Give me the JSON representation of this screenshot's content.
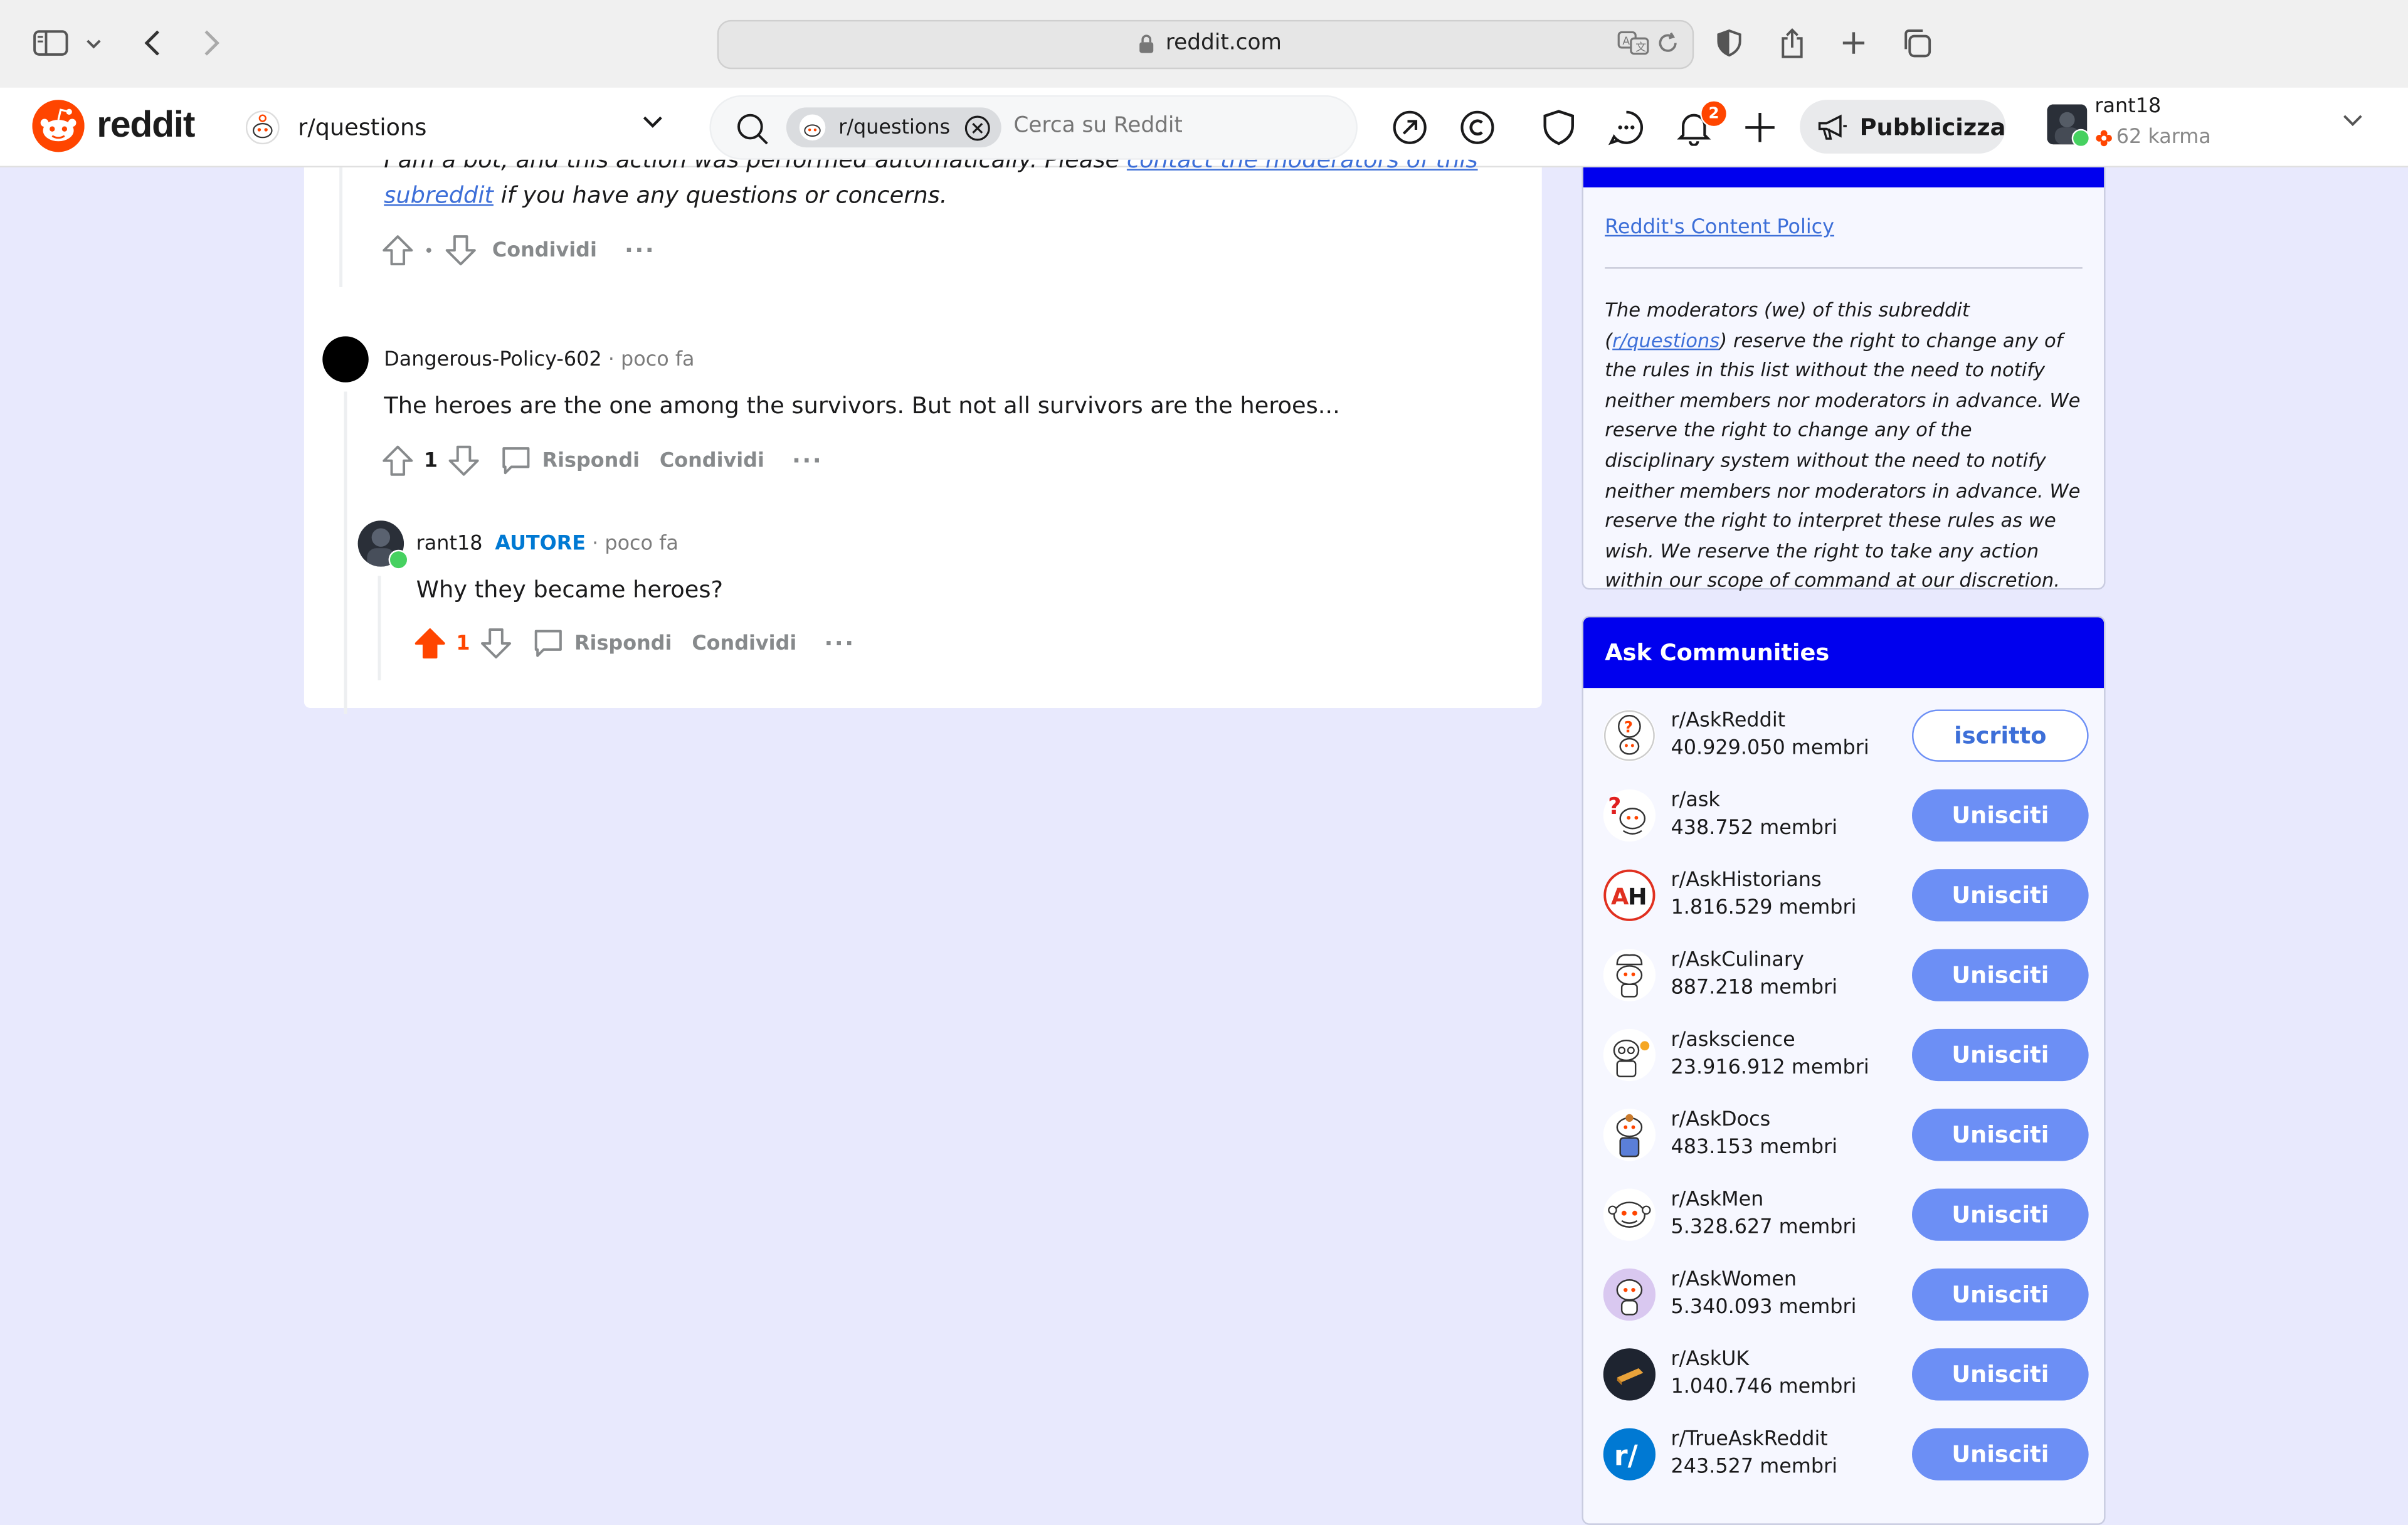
{
  "browser": {
    "url": "reddit.com"
  },
  "header": {
    "logo_text": "reddit",
    "subreddit": "r/questions",
    "search_chip": "r/questions",
    "search_placeholder": "Cerca su Reddit",
    "notification_count": "2",
    "advertise_label": "Pubblicizza",
    "username": "rant18",
    "karma": "62 karma"
  },
  "comments": {
    "mod_comment": {
      "line1_partial": "I am a bot, and this action was performed automatically. Please",
      "link_partial": "contact the moderators of this",
      "link2": "subreddit",
      "tail": "if you have any questions or concerns.",
      "vote_dot": "•",
      "share": "Condividi",
      "more": "···"
    },
    "comment1": {
      "author": "Dangerous-Policy-602",
      "time": "· poco fa",
      "body": "The heroes are the one among the survivors. But not all survivors are the heroes...",
      "votes": "1",
      "reply": "Rispondi",
      "share": "Condividi",
      "more": "···"
    },
    "comment2": {
      "author": "rant18",
      "op_badge": "AUTORE",
      "time": "· poco fa",
      "body": "Why they became heroes?",
      "votes": "1",
      "reply": "Rispondi",
      "share": "Condividi",
      "more": "···"
    }
  },
  "sidebar": {
    "policy_link": "Reddit's Content Policy",
    "policy_text_1": "The moderators (we) of this subreddit (",
    "policy_text_link": "r/questions",
    "policy_text_2": ") reserve the right to change any of the rules in this list without the need to notify neither members nor moderators in advance. We reserve the right to change any of the disciplinary system without the need to notify neither members nor moderators in advance. We reserve the right to interpret these rules as we wish. We reserve the right to take any action within our scope of command at our discretion.",
    "ask_title": "Ask Communities",
    "communities": [
      {
        "name": "r/AskReddit",
        "members": "40.929.050 membri",
        "button": "iscritto",
        "joined": true,
        "icon": "askreddit-icon"
      },
      {
        "name": "r/ask",
        "members": "438.752 membri",
        "button": "Unisciti",
        "joined": false,
        "icon": "ask-icon"
      },
      {
        "name": "r/AskHistorians",
        "members": "1.816.529 membri",
        "button": "Unisciti",
        "joined": false,
        "icon": "askhistorians-icon"
      },
      {
        "name": "r/AskCulinary",
        "members": "887.218 membri",
        "button": "Unisciti",
        "joined": false,
        "icon": "askculinary-icon"
      },
      {
        "name": "r/askscience",
        "members": "23.916.912 membri",
        "button": "Unisciti",
        "joined": false,
        "icon": "askscience-icon"
      },
      {
        "name": "r/AskDocs",
        "members": "483.153 membri",
        "button": "Unisciti",
        "joined": false,
        "icon": "askdocs-icon"
      },
      {
        "name": "r/AskMen",
        "members": "5.328.627 membri",
        "button": "Unisciti",
        "joined": false,
        "icon": "askmen-icon"
      },
      {
        "name": "r/AskWomen",
        "members": "5.340.093 membri",
        "button": "Unisciti",
        "joined": false,
        "icon": "askwomen-icon"
      },
      {
        "name": "r/AskUK",
        "members": "1.040.746 membri",
        "button": "Unisciti",
        "joined": false,
        "icon": "askuk-icon"
      },
      {
        "name": "r/TrueAskReddit",
        "members": "243.527 membri",
        "button": "Unisciti",
        "joined": false,
        "icon": "trueaskreddit-icon"
      }
    ]
  },
  "colors": {
    "accent_blue": "#0000ee",
    "join_button": "#6c8ff5",
    "upvote_active": "#ff4500",
    "page_bg": "#e8e9fd"
  }
}
